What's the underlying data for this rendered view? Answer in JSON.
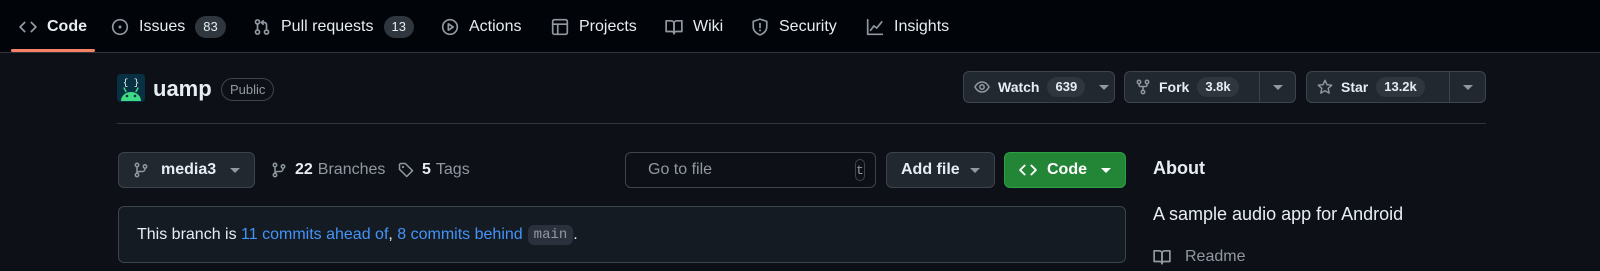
{
  "nav": {
    "items": [
      {
        "label": "Code",
        "icon": "code-icon"
      },
      {
        "label": "Issues",
        "icon": "issue-opened-icon",
        "count": "83"
      },
      {
        "label": "Pull requests",
        "icon": "git-pull-request-icon",
        "count": "13"
      },
      {
        "label": "Actions",
        "icon": "play-icon"
      },
      {
        "label": "Projects",
        "icon": "table-icon"
      },
      {
        "label": "Wiki",
        "icon": "book-icon"
      },
      {
        "label": "Security",
        "icon": "shield-icon"
      },
      {
        "label": "Insights",
        "icon": "graph-icon"
      }
    ]
  },
  "repo": {
    "name": "uamp",
    "visibility": "Public",
    "watch": {
      "label": "Watch",
      "count": "639"
    },
    "fork": {
      "label": "Fork",
      "count": "3.8k"
    },
    "star": {
      "label": "Star",
      "count": "13.2k"
    }
  },
  "files": {
    "branch": "media3",
    "branches_count": "22",
    "branches_label": "Branches",
    "tags_count": "5",
    "tags_label": "Tags",
    "goto_placeholder": "Go to file",
    "goto_shortcut": "t",
    "add_file": "Add file",
    "code": "Code"
  },
  "branch_status": {
    "prefix": "This branch is ",
    "ahead": "11 commits ahead of",
    "separator": ", ",
    "behind": "8 commits behind",
    "base": "main",
    "suffix": "."
  },
  "about": {
    "title": "About",
    "description": "A sample audio app for Android",
    "readme": "Readme"
  },
  "colors": {
    "accent_underline": "#f78166",
    "link": "#4493f8",
    "code_button": "#238636",
    "background": "#0d1117"
  }
}
